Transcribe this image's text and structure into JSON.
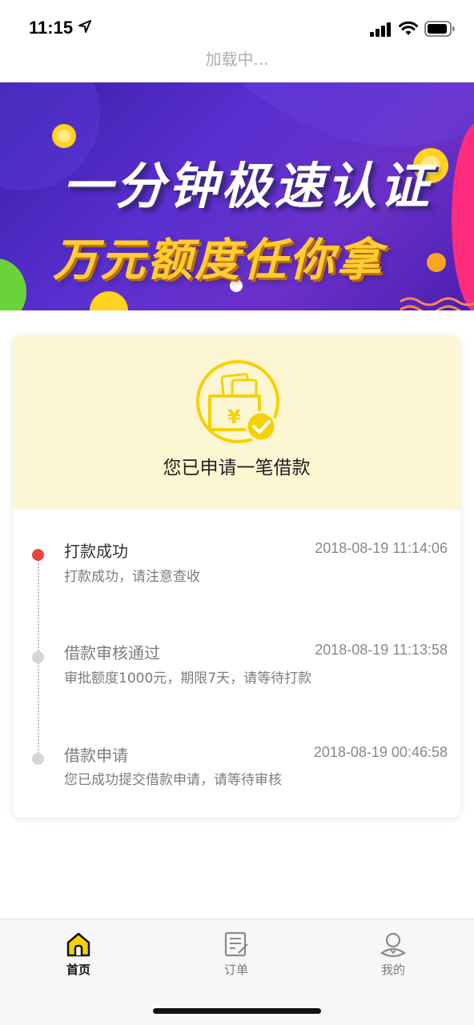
{
  "status_bar": {
    "time": "11:15"
  },
  "loading": "加载中...",
  "banner": {
    "headline_1": "一分钟极速认证",
    "headline_2": "万元额度任你拿"
  },
  "card": {
    "title": "您已申请一笔借款",
    "timeline": [
      {
        "title": "打款成功",
        "time": "2018-08-19 11:14:06",
        "desc": "打款成功，请注意查收",
        "active": true
      },
      {
        "title": "借款审核通过",
        "time": "2018-08-19 11:13:58",
        "desc": "审批额度1000元，期限7天，请等待打款",
        "active": false
      },
      {
        "title": "借款申请",
        "time": "2018-08-19 00:46:58",
        "desc": "您已成功提交借款申请，请等待审核",
        "active": false
      }
    ]
  },
  "tabbar": {
    "items": [
      {
        "label": "首页",
        "icon": "home-icon",
        "active": true
      },
      {
        "label": "订单",
        "icon": "order-icon",
        "active": false
      },
      {
        "label": "我的",
        "icon": "profile-icon",
        "active": false
      }
    ]
  },
  "colors": {
    "accent": "#f5d100",
    "active_dot": "#e9463c",
    "inactive_dot": "#d6d6d6",
    "card_top_bg": "#fdf6d2"
  }
}
